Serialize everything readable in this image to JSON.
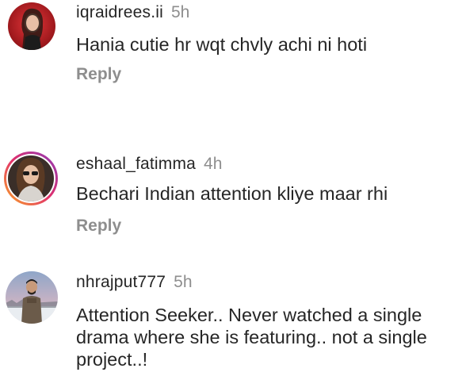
{
  "comments": [
    {
      "username": "iqraidrees.ii",
      "time": "5h",
      "text": "Hania cutie hr wqt chvly achi ni hoti",
      "reply_label": "Reply",
      "avatar_icon": "profile-photo-icon"
    },
    {
      "username": "eshaal_fatimma",
      "time": "4h",
      "text": "Bechari Indian attention kliye maar rhi",
      "reply_label": "Reply",
      "avatar_icon": "profile-photo-icon",
      "has_story_ring": true
    },
    {
      "username": "nhrajput777",
      "time": "5h",
      "text": "Attention Seeker.. Never watched a single drama where she is featuring.. not a single project..!",
      "avatar_icon": "profile-photo-icon"
    }
  ],
  "colors": {
    "text": "#262626",
    "secondary": "#8e8e8e",
    "background": "#ffffff"
  }
}
